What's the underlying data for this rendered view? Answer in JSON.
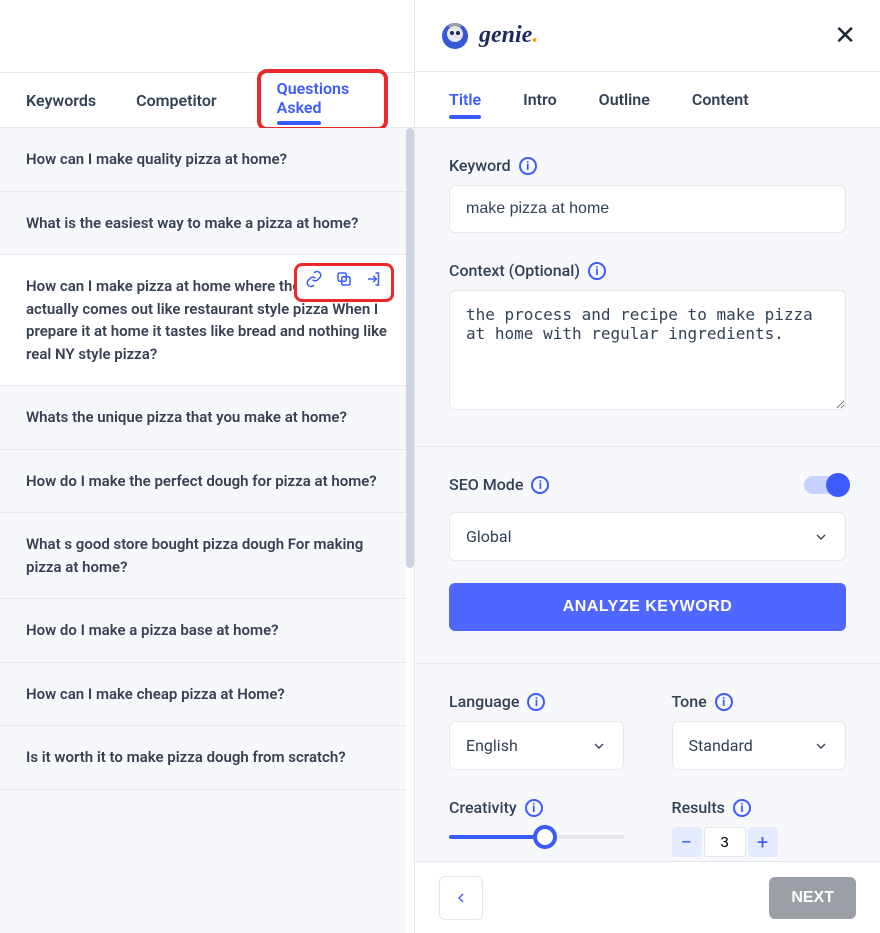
{
  "left": {
    "tabs": [
      "Keywords",
      "Competitor",
      "Questions Asked"
    ],
    "active_tab_index": 2,
    "questions": [
      "How can I make quality pizza at home?",
      "What is the easiest way to make a pizza at home?",
      "How can I make pizza at home where the crust actually comes out like restaurant style pizza When I prepare it at home it tastes like bread and nothing like real NY style pizza?",
      "Whats the unique pizza that you make at home?",
      "How do I make the perfect dough for pizza at home?",
      "What s good store bought pizza dough For making pizza at home?",
      "How do I make a pizza base at home?",
      "How can I make cheap pizza at Home?",
      "Is it worth it to make pizza dough from scratch?"
    ],
    "hovered_index": 2
  },
  "right": {
    "brand": "genie",
    "tabs": [
      "Title",
      "Intro",
      "Outline",
      "Content"
    ],
    "active_tab_index": 0,
    "keyword_label": "Keyword",
    "keyword_value": "make pizza at home",
    "context_label": "Context (Optional)",
    "context_value": "the process and recipe to make pizza at home with regular ingredients.",
    "seo_label": "SEO Mode",
    "seo_on": true,
    "seo_select": "Global",
    "analyze_label": "ANALYZE KEYWORD",
    "language_label": "Language",
    "language_value": "English",
    "tone_label": "Tone",
    "tone_value": "Standard",
    "creativity_label": "Creativity",
    "results_label": "Results",
    "results_value": "3",
    "next_label": "NEXT"
  }
}
